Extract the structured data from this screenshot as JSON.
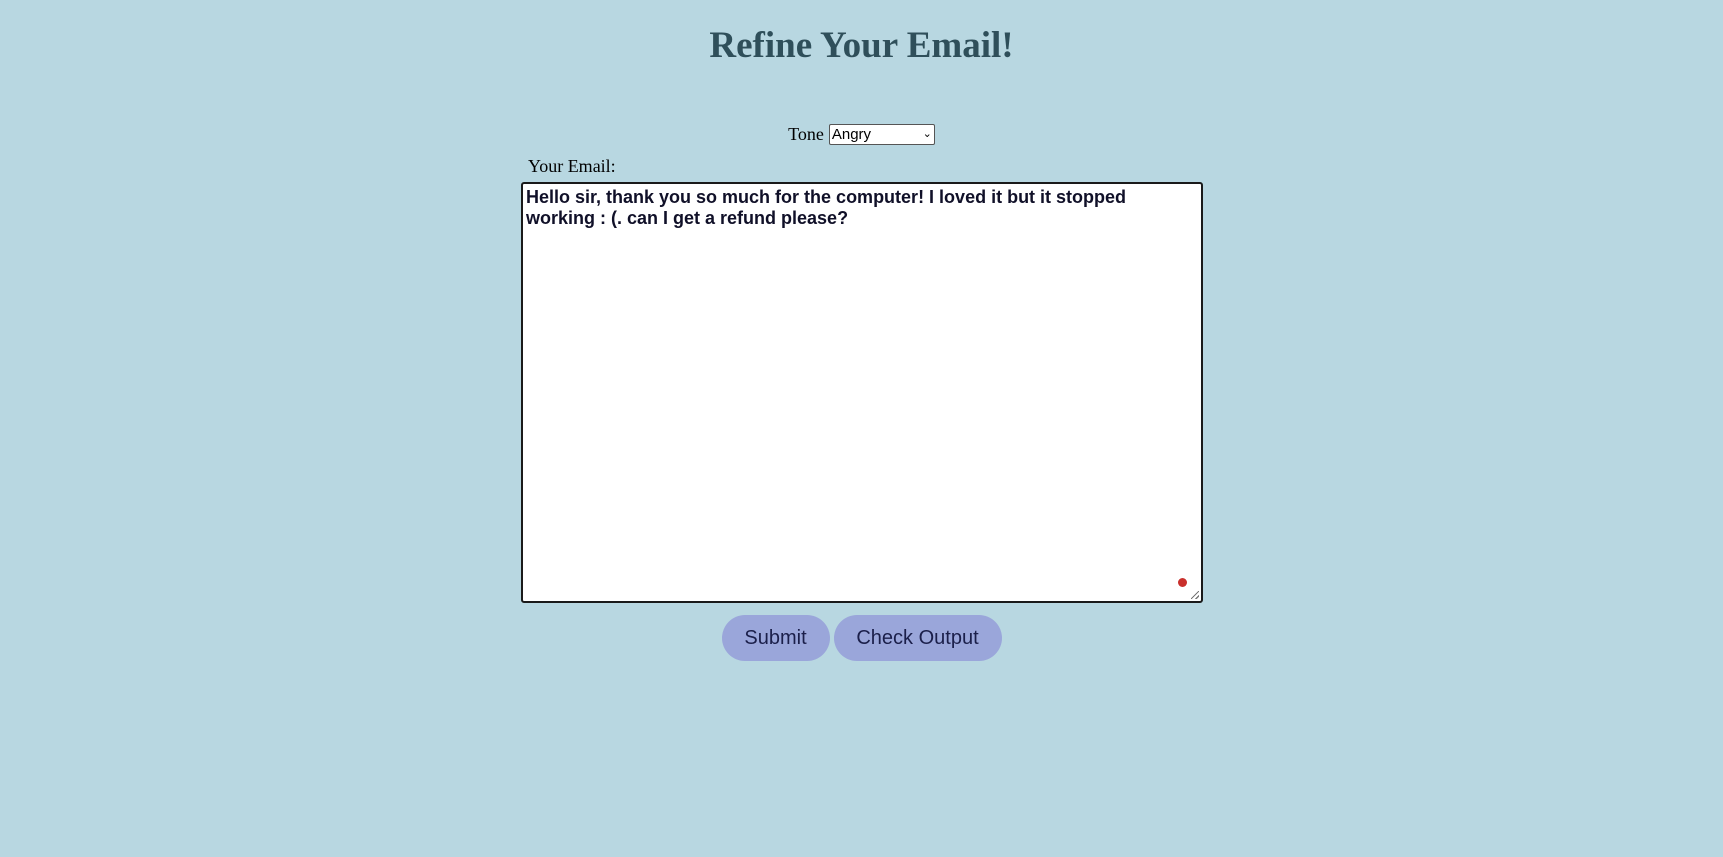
{
  "page": {
    "title": "Refine Your Email!"
  },
  "tone": {
    "label": "Tone",
    "selected": "Angry"
  },
  "email": {
    "label": "Your Email:",
    "value": "Hello sir, thank you so much for the computer! I loved it but it stopped working : (. can I get a refund please?"
  },
  "buttons": {
    "submit_label": "Submit",
    "check_output_label": "Check Output"
  },
  "colors": {
    "background": "#b8d7e1",
    "button": "#9aa6da",
    "title": "#2f4f5a"
  },
  "icons": {
    "select_arrow": "chevron-down-icon"
  }
}
